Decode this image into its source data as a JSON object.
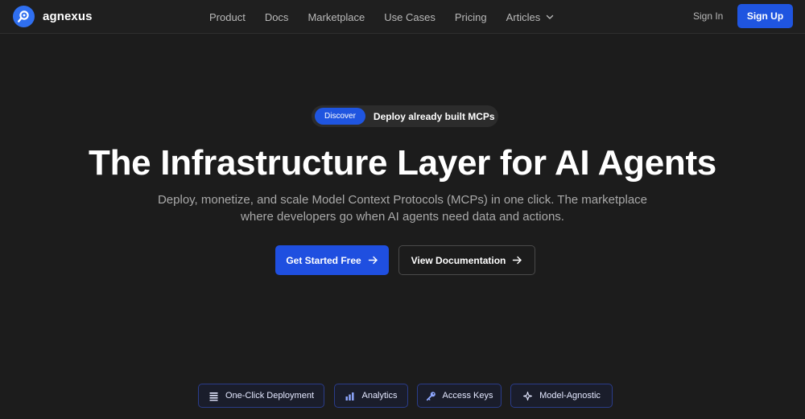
{
  "brand": {
    "name": "agnexus",
    "logo_icon": "agnexus-logo-icon",
    "accent": "#2f6ff0"
  },
  "nav": {
    "links": [
      {
        "label": "Product"
      },
      {
        "label": "Docs"
      },
      {
        "label": "Marketplace"
      },
      {
        "label": "Use Cases"
      },
      {
        "label": "Pricing"
      },
      {
        "label": "Articles",
        "icon": "chevron-down-icon"
      }
    ],
    "sign_in": "Sign In",
    "sign_up": "Sign Up"
  },
  "discover": {
    "badge": "Discover",
    "text": "Deploy already built MCPs",
    "icon": "chevron-right-icon"
  },
  "hero": {
    "title": "The Infrastructure Layer for AI Agents",
    "subtitle": "Deploy, monetize, and scale Model Context Protocols (MCPs) in one click. The marketplace where developers go when AI agents need data and actions."
  },
  "cta": {
    "primary": "Get Started Free",
    "secondary": "View Documentation",
    "icon": "arrow-right-icon"
  },
  "features": [
    {
      "label": "One-Click Deployment",
      "icon": "list-icon"
    },
    {
      "label": "Analytics",
      "icon": "bar-chart-icon"
    },
    {
      "label": "Access Keys",
      "icon": "key-icon"
    },
    {
      "label": "Model-Agnostic",
      "icon": "sparkle-icon"
    }
  ],
  "colors": {
    "background": "#1c1c1c",
    "primary_button": "#1f4fe0",
    "chip_border": "#2a3c8a",
    "chip_icon": "#8fa8ff"
  }
}
